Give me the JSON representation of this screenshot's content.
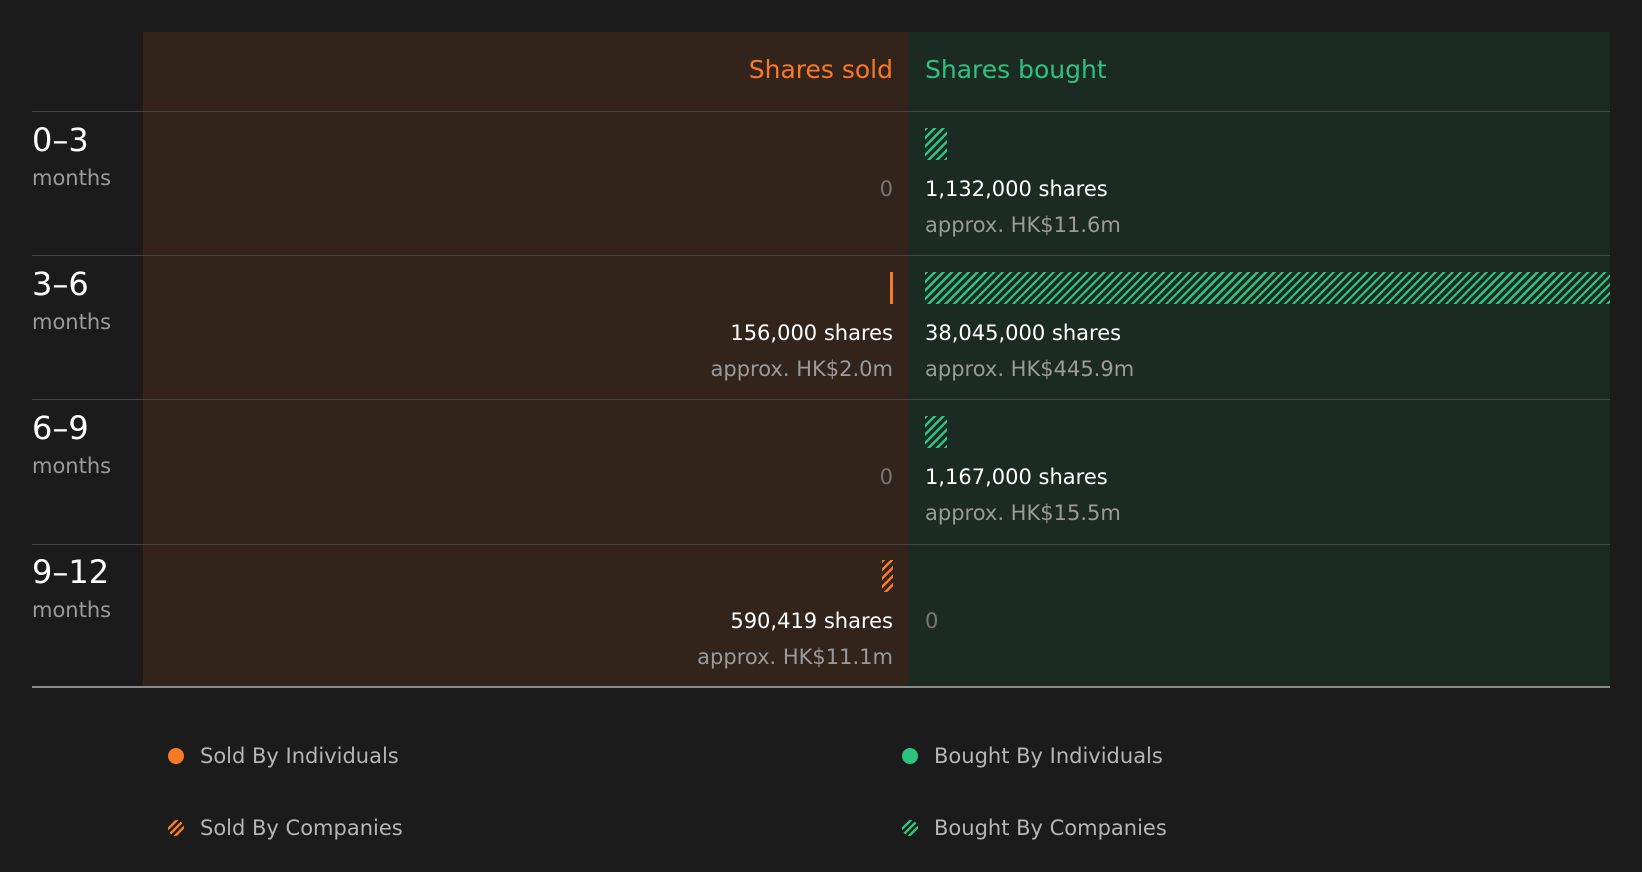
{
  "chart_data": {
    "type": "bar",
    "orientation": "horizontal-diverging",
    "columns": {
      "sold": "Shares sold",
      "bought": "Shares bought"
    },
    "categories": [
      {
        "range": "0–3",
        "unit": "months"
      },
      {
        "range": "3–6",
        "unit": "months"
      },
      {
        "range": "6–9",
        "unit": "months"
      },
      {
        "range": "9–12",
        "unit": "months"
      }
    ],
    "rows": [
      {
        "sold": {
          "zero_label": "0",
          "individuals": 0,
          "companies": 0
        },
        "bought": {
          "shares_label": "1,132,000 shares",
          "approx_label": "approx. HK$11.6m",
          "individuals": 0,
          "companies": 1132000
        }
      },
      {
        "sold": {
          "shares_label": "156,000 shares",
          "approx_label": "approx. HK$2.0m",
          "individuals": 156000,
          "companies": 0
        },
        "bought": {
          "shares_label": "38,045,000 shares",
          "approx_label": "approx. HK$445.9m",
          "individuals": 0,
          "companies": 38045000
        }
      },
      {
        "sold": {
          "zero_label": "0",
          "individuals": 0,
          "companies": 0
        },
        "bought": {
          "shares_label": "1,167,000 shares",
          "approx_label": "approx. HK$15.5m",
          "individuals": 0,
          "companies": 1167000
        }
      },
      {
        "sold": {
          "shares_label": "590,419 shares",
          "approx_label": "approx. HK$11.1m",
          "individuals": 0,
          "companies": 590419
        },
        "bought": {
          "zero_label": "0",
          "individuals": 0,
          "companies": 0
        }
      }
    ],
    "legend": [
      {
        "label": "Sold By Individuals",
        "style": "solid",
        "color": "#f97a25"
      },
      {
        "label": "Bought By Individuals",
        "style": "solid",
        "color": "#2ec27f"
      },
      {
        "label": "Sold By Companies",
        "style": "hatched",
        "color": "#f97a25"
      },
      {
        "label": "Bought By Companies",
        "style": "hatched",
        "color": "#2ec27f"
      }
    ],
    "colors": {
      "sold": "#f97a25",
      "bought": "#2ec27f",
      "sold_bg": "#32231b",
      "bought_bg": "#1b2b24",
      "page_bg": "#1b1b1b"
    }
  }
}
